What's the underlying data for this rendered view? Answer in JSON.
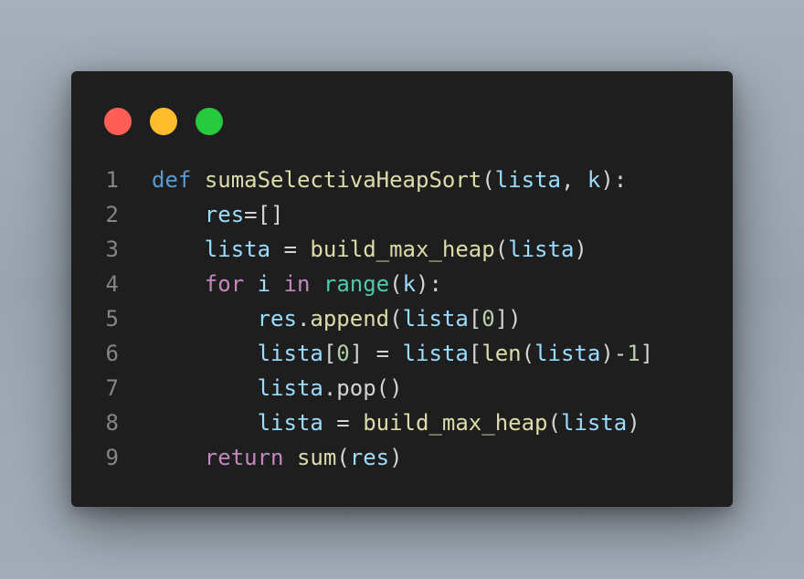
{
  "window": {
    "colors": {
      "background": "#1e1e1e",
      "dot_red": "#ff5f56",
      "dot_yellow": "#ffbd2e",
      "dot_green": "#27c93f"
    }
  },
  "editor": {
    "language": "python",
    "lines": [
      {
        "number": "1",
        "tokens": [
          {
            "text": "def",
            "type": "kw"
          },
          {
            "text": " ",
            "type": "punc"
          },
          {
            "text": "sumaSelectivaHeapSort",
            "type": "fn"
          },
          {
            "text": "(",
            "type": "punc"
          },
          {
            "text": "lista",
            "type": "var"
          },
          {
            "text": ", ",
            "type": "punc"
          },
          {
            "text": "k",
            "type": "var"
          },
          {
            "text": "):",
            "type": "punc"
          }
        ]
      },
      {
        "number": "2",
        "tokens": [
          {
            "text": "    ",
            "type": "punc"
          },
          {
            "text": "res",
            "type": "var"
          },
          {
            "text": "=[]",
            "type": "punc"
          }
        ]
      },
      {
        "number": "3",
        "tokens": [
          {
            "text": "    ",
            "type": "punc"
          },
          {
            "text": "lista",
            "type": "var"
          },
          {
            "text": " = ",
            "type": "punc"
          },
          {
            "text": "build_max_heap",
            "type": "fn"
          },
          {
            "text": "(",
            "type": "punc"
          },
          {
            "text": "lista",
            "type": "var"
          },
          {
            "text": ")",
            "type": "punc"
          }
        ]
      },
      {
        "number": "4",
        "tokens": [
          {
            "text": "    ",
            "type": "punc"
          },
          {
            "text": "for",
            "type": "ctrl"
          },
          {
            "text": " ",
            "type": "punc"
          },
          {
            "text": "i",
            "type": "var"
          },
          {
            "text": " ",
            "type": "punc"
          },
          {
            "text": "in",
            "type": "ctrl"
          },
          {
            "text": " ",
            "type": "punc"
          },
          {
            "text": "range",
            "type": "builtin"
          },
          {
            "text": "(",
            "type": "punc"
          },
          {
            "text": "k",
            "type": "var"
          },
          {
            "text": "):",
            "type": "punc"
          }
        ]
      },
      {
        "number": "5",
        "tokens": [
          {
            "text": "        ",
            "type": "punc"
          },
          {
            "text": "res",
            "type": "var"
          },
          {
            "text": ".",
            "type": "punc"
          },
          {
            "text": "append",
            "type": "fn"
          },
          {
            "text": "(",
            "type": "punc"
          },
          {
            "text": "lista",
            "type": "var"
          },
          {
            "text": "[",
            "type": "punc"
          },
          {
            "text": "0",
            "type": "num"
          },
          {
            "text": "])",
            "type": "punc"
          }
        ]
      },
      {
        "number": "6",
        "tokens": [
          {
            "text": "        ",
            "type": "punc"
          },
          {
            "text": "lista",
            "type": "var"
          },
          {
            "text": "[",
            "type": "punc"
          },
          {
            "text": "0",
            "type": "num"
          },
          {
            "text": "] = ",
            "type": "punc"
          },
          {
            "text": "lista",
            "type": "var"
          },
          {
            "text": "[",
            "type": "punc"
          },
          {
            "text": "len",
            "type": "fn"
          },
          {
            "text": "(",
            "type": "punc"
          },
          {
            "text": "lista",
            "type": "var"
          },
          {
            "text": ")-",
            "type": "punc"
          },
          {
            "text": "1",
            "type": "num"
          },
          {
            "text": "]",
            "type": "punc"
          }
        ]
      },
      {
        "number": "7",
        "tokens": [
          {
            "text": "        ",
            "type": "punc"
          },
          {
            "text": "lista",
            "type": "var"
          },
          {
            "text": ".pop()",
            "type": "punc"
          }
        ]
      },
      {
        "number": "8",
        "tokens": [
          {
            "text": "        ",
            "type": "punc"
          },
          {
            "text": "lista",
            "type": "var"
          },
          {
            "text": " = ",
            "type": "punc"
          },
          {
            "text": "build_max_heap",
            "type": "fn"
          },
          {
            "text": "(",
            "type": "punc"
          },
          {
            "text": "lista",
            "type": "var"
          },
          {
            "text": ")",
            "type": "punc"
          }
        ]
      },
      {
        "number": "9",
        "tokens": [
          {
            "text": "    ",
            "type": "punc"
          },
          {
            "text": "return",
            "type": "ctrl"
          },
          {
            "text": " ",
            "type": "punc"
          },
          {
            "text": "sum",
            "type": "fn"
          },
          {
            "text": "(",
            "type": "punc"
          },
          {
            "text": "res",
            "type": "var"
          },
          {
            "text": ")",
            "type": "punc"
          }
        ]
      }
    ]
  }
}
